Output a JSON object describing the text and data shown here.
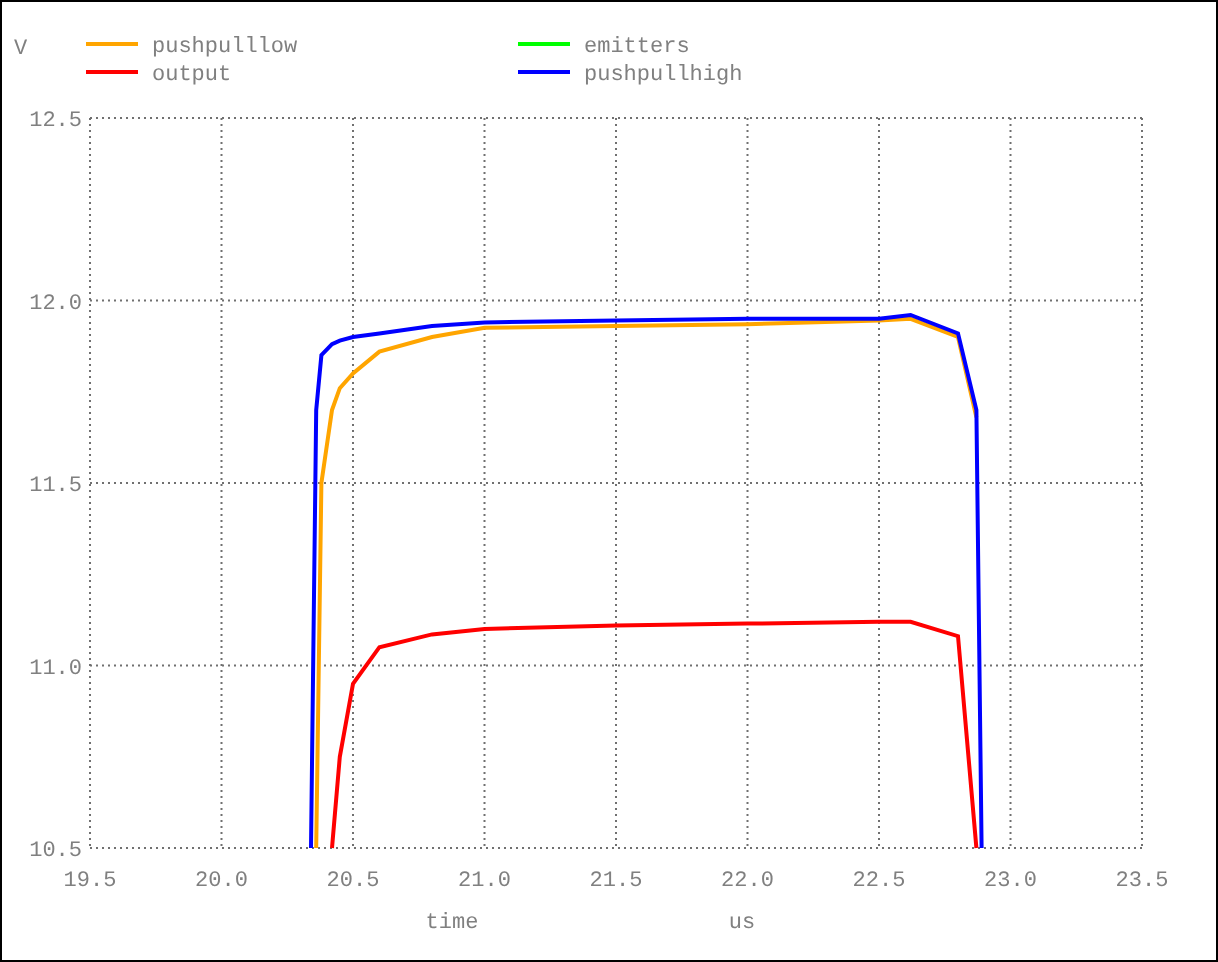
{
  "plot": {
    "xunit": "us",
    "chart_data": {
      "type": "line",
      "ylabel": "V",
      "xlabel": "time",
      "grid": true,
      "legend": "top",
      "x": [
        20.34,
        20.36,
        20.38,
        20.42,
        20.45,
        20.5,
        20.6,
        20.8,
        21.0,
        21.5,
        22.0,
        22.5,
        22.62,
        22.8,
        22.87,
        22.89
      ],
      "series": [
        {
          "name": "pushpulllow",
          "color": "#ffa500",
          "values": [
            null,
            10.5,
            11.5,
            11.7,
            11.76,
            11.8,
            11.86,
            11.9,
            11.925,
            11.93,
            11.935,
            11.945,
            11.95,
            11.9,
            11.68,
            null
          ]
        },
        {
          "name": "emitters",
          "color": "#00ff00",
          "values": [
            null,
            null,
            null,
            null,
            null,
            null,
            null,
            null,
            null,
            null,
            null,
            null,
            null,
            null,
            null,
            null
          ]
        },
        {
          "name": "output",
          "color": "#ff0000",
          "values": [
            null,
            null,
            null,
            10.5,
            10.75,
            10.95,
            11.05,
            11.085,
            11.1,
            11.11,
            11.115,
            11.12,
            11.12,
            11.08,
            10.5,
            null
          ]
        },
        {
          "name": "pushpullhigh",
          "color": "#0000ff",
          "values": [
            10.5,
            11.7,
            11.85,
            11.88,
            11.89,
            11.9,
            11.91,
            11.93,
            11.94,
            11.945,
            11.95,
            11.95,
            11.96,
            11.91,
            11.7,
            10.5
          ]
        }
      ],
      "xlim": [
        19.5,
        23.5
      ],
      "ylim": [
        10.5,
        12.5
      ],
      "xticks": [
        {
          "value": 19.5,
          "label": "19.5"
        },
        {
          "value": 20,
          "label": "20.0"
        },
        {
          "value": 20.5,
          "label": "20.5"
        },
        {
          "value": 21,
          "label": "21.0"
        },
        {
          "value": 21.5,
          "label": "21.5"
        },
        {
          "value": 22,
          "label": "22.0"
        },
        {
          "value": 22.5,
          "label": "22.5"
        },
        {
          "value": 23,
          "label": "23.0"
        },
        {
          "value": 23.5,
          "label": "23.5"
        }
      ],
      "yticks": [
        {
          "value": 10.5,
          "label": "10.5"
        },
        {
          "value": 11,
          "label": "11.0"
        },
        {
          "value": 11.5,
          "label": "11.5"
        },
        {
          "value": 12,
          "label": "12.0"
        },
        {
          "value": 12.5,
          "label": "12.5"
        }
      ]
    }
  }
}
